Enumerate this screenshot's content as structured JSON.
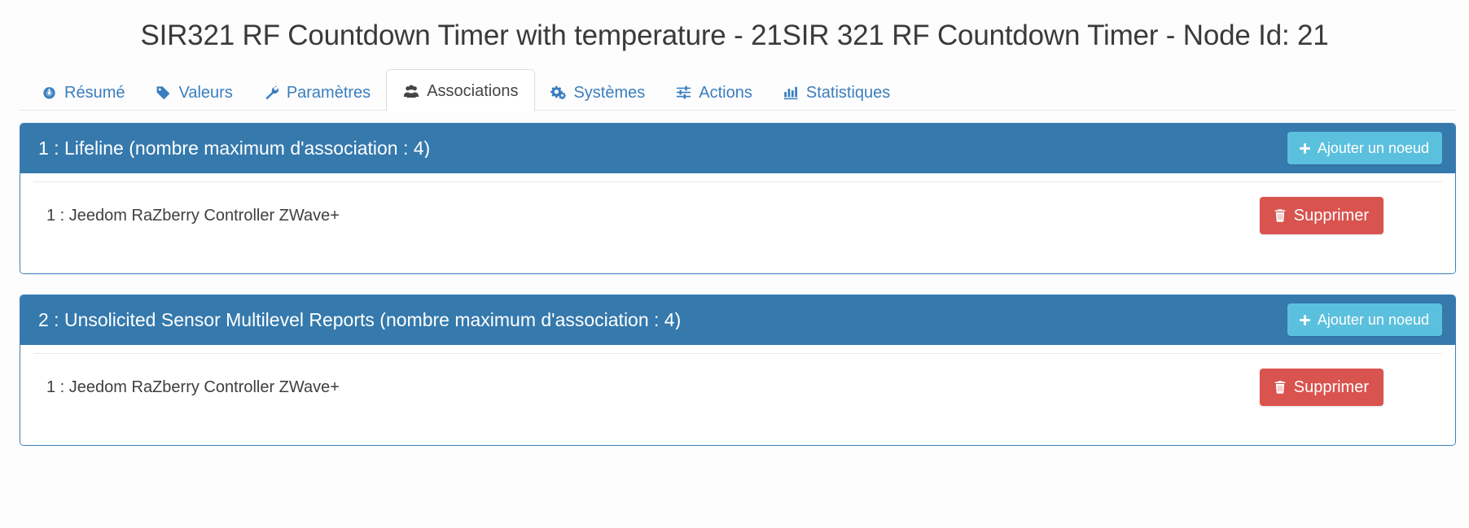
{
  "header": {
    "title": "SIR321 RF Countdown Timer with temperature - 21SIR 321 RF Countdown Timer - Node Id: 21"
  },
  "tabs": [
    {
      "label": "Résumé",
      "icon": "dashboard-icon",
      "active": false
    },
    {
      "label": "Valeurs",
      "icon": "tag-icon",
      "active": false
    },
    {
      "label": "Paramètres",
      "icon": "wrench-icon",
      "active": false
    },
    {
      "label": "Associations",
      "icon": "users-icon",
      "active": true
    },
    {
      "label": "Systèmes",
      "icon": "cogs-icon",
      "active": false
    },
    {
      "label": "Actions",
      "icon": "sliders-icon",
      "active": false
    },
    {
      "label": "Statistiques",
      "icon": "bar-chart-icon",
      "active": false
    }
  ],
  "groups": [
    {
      "title": "1 : Lifeline (nombre maximum d'association : 4)",
      "add_label": "Ajouter un noeud",
      "nodes": [
        {
          "label": "1 : Jeedom RaZberry Controller ZWave+",
          "delete_label": "Supprimer"
        }
      ]
    },
    {
      "title": "2 : Unsolicited Sensor Multilevel Reports (nombre maximum d'association : 4)",
      "add_label": "Ajouter un noeud",
      "nodes": [
        {
          "label": "1 : Jeedom RaZberry Controller ZWave+",
          "delete_label": "Supprimer"
        }
      ]
    }
  ],
  "colors": {
    "panel_header": "#3579ad",
    "panel_border": "#3a7fb8",
    "tab_link": "#3a7ebf",
    "btn_info": "#5bc0de",
    "btn_danger": "#d9534f"
  }
}
